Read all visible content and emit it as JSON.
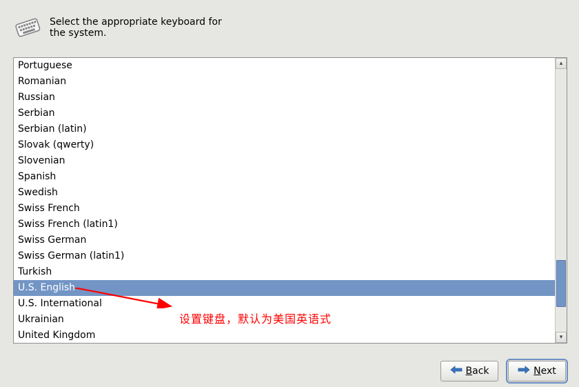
{
  "header": {
    "instruction": "Select the appropriate keyboard for the system."
  },
  "list": {
    "selected_index": 14,
    "items": [
      "Portuguese",
      "Romanian",
      "Russian",
      "Serbian",
      "Serbian (latin)",
      "Slovak (qwerty)",
      "Slovenian",
      "Spanish",
      "Swedish",
      "Swiss French",
      "Swiss French (latin1)",
      "Swiss German",
      "Swiss German (latin1)",
      "Turkish",
      "U.S. English",
      "U.S. International",
      "Ukrainian",
      "United Kingdom"
    ]
  },
  "buttons": {
    "back": "Back",
    "next": "Next"
  },
  "annotation": "设置键盘，默认为美国英语式"
}
